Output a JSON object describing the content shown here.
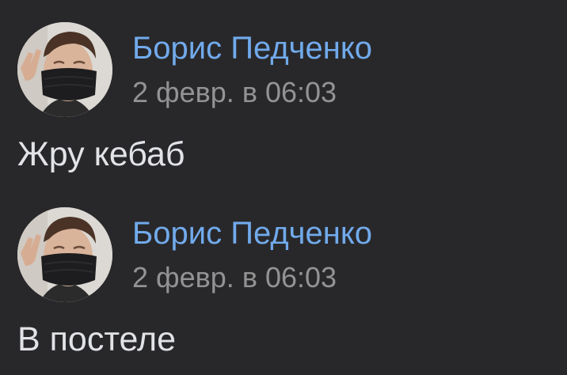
{
  "messages": [
    {
      "author": "Борис Педченко",
      "date": "2 февр. в 06:03",
      "text": "Жру кебаб"
    },
    {
      "author": "Борис Педченко",
      "date": "2 февр. в 06:03",
      "text": "В постеле"
    }
  ],
  "colors": {
    "background": "#28282b",
    "author_link": "#71aaeb",
    "date": "#939393",
    "message_text": "#e1e3e6"
  }
}
